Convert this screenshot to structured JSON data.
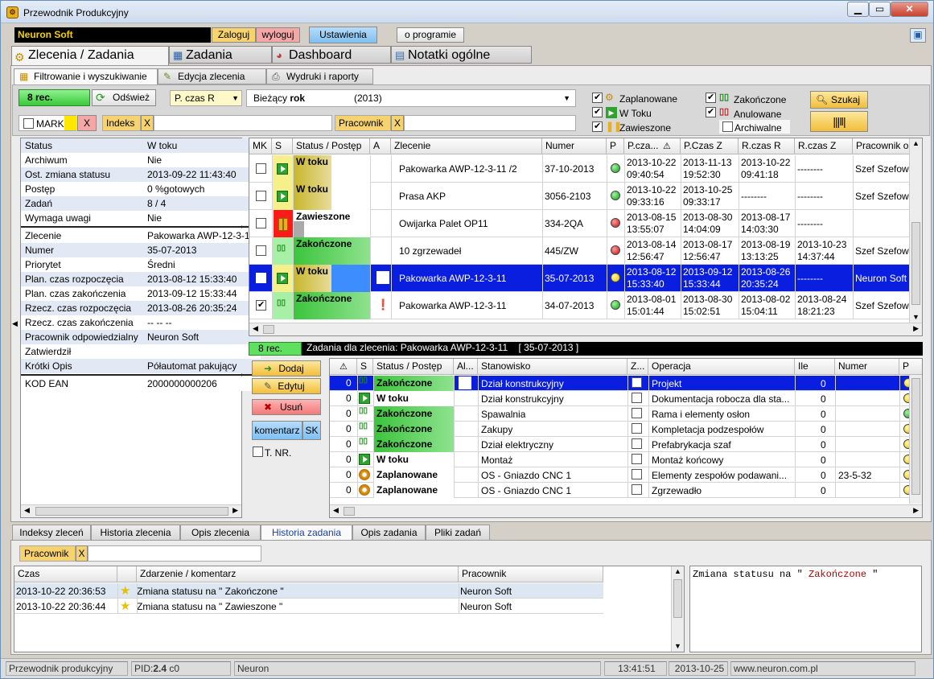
{
  "window": {
    "title": "Przewodnik Produkcyjny"
  },
  "topbar": {
    "brand": "Neuron Soft",
    "login": "Zaloguj",
    "logout": "wyloguj",
    "settings": "Ustawienia",
    "about": "o programie"
  },
  "main_tabs": [
    "Zlecenia / Zadania",
    "Zadania",
    "Dashboard",
    "Notatki ogólne"
  ],
  "sub_tabs": [
    "Filtrowanie i wyszukiwanie",
    "Edycja zlecenia",
    "Wydruki i raporty"
  ],
  "filter": {
    "rec_count": "8 rec.",
    "refresh": "Odśwież",
    "time_field": "P. czas R",
    "period_label": "Bieżący",
    "period_bold": "rok",
    "period_year": "(2013)",
    "mark": "MARK",
    "x": "X",
    "index_label": "Indeks",
    "index_value": "",
    "worker_label": "Pracownik",
    "worker_value": "",
    "cb_planned": "Zaplanowane",
    "cb_inprogress": "W Toku",
    "cb_suspended": "Zawieszone",
    "cb_finished": "Zakończone",
    "cb_cancelled": "Anulowane",
    "cb_archived": "Archiwalne",
    "search": "Szukaj"
  },
  "details": [
    {
      "k": "Status",
      "v": "W toku",
      "hl": true
    },
    {
      "k": "Archiwum",
      "v": "Nie"
    },
    {
      "k": "Ost. zmiana statusu",
      "v": "2013-09-22  11:43:40",
      "hl": true
    },
    {
      "k": "Postęp",
      "v": "0 %gotowych"
    },
    {
      "k": "Zadań",
      "v": "8 / 4",
      "hl": true
    },
    {
      "k": "Wymaga uwagi",
      "v": "Nie"
    },
    {
      "k": "Zlecenie",
      "v": "Pakowarka AWP-12-3-11"
    },
    {
      "k": "Numer",
      "v": "35-07-2013",
      "hl": true
    },
    {
      "k": "Priorytet",
      "v": "Średni"
    },
    {
      "k": "Plan. czas rozpoczęcia",
      "v": "2013-08-12  15:33:40",
      "hl": true
    },
    {
      "k": "Plan. czas zakończenia",
      "v": "2013-09-12  15:33:44"
    },
    {
      "k": "Rzecz. czas rozpoczęcia",
      "v": "2013-08-26  20:35:24",
      "hl": true
    },
    {
      "k": "Rzecz. czas zakończenia",
      "v": "-- --  --"
    },
    {
      "k": "Pracownik odpowiedzialny",
      "v": "Neuron Soft",
      "hl": true
    },
    {
      "k": "Zatwierdził",
      "v": ""
    },
    {
      "k": "Krótki Opis",
      "v": "Półautomat pakujący",
      "hl": true
    },
    {
      "k": "KOD EAN",
      "v": "2000000000206"
    }
  ],
  "orders": {
    "headers": [
      "MK",
      "S",
      "Status / Postęp",
      "A",
      "Zlecenie",
      "Numer",
      "P",
      "P.cza...",
      "P.Czas Z",
      "R.czas R",
      "R.czas Z",
      "Pracownik o"
    ],
    "rows": [
      {
        "mk": false,
        "status": "W toku",
        "zlecenie": "Pakowarka AWP-12-3-11 /2",
        "numer": "37-10-2013",
        "p": "green",
        "pczas": "2013-10-22\n09:40:54",
        "pczasz": "2013-11-13\n19:52:30",
        "rczasr": "2013-10-22\n09:41:18",
        "rczasz": "--------",
        "prac": "Szef Szefowi"
      },
      {
        "mk": false,
        "status": "W toku",
        "zlecenie": "Prasa AKP",
        "numer": "3056-2103",
        "p": "green",
        "pczas": "2013-10-22\n09:33:16",
        "pczasz": "2013-10-25\n09:33:17",
        "rczasr": "--------",
        "rczasz": "--------",
        "prac": "Szef Szefowi"
      },
      {
        "mk": false,
        "status": "Zawieszone",
        "zlecenie": "Owijarka Palet OP11",
        "numer": "334-2QA",
        "p": "red",
        "pczas": "2013-08-15\n13:55:07",
        "pczasz": "2013-08-30\n14:04:09",
        "rczasr": "2013-08-17\n14:03:30",
        "rczasz": "--------",
        "prac": ""
      },
      {
        "mk": false,
        "status": "Zakończone",
        "zlecenie": "10 zgrzewadeł",
        "numer": "445/ZW",
        "p": "red",
        "pczas": "2013-08-14\n12:56:47",
        "pczasz": "2013-08-17\n12:56:47",
        "rczasr": "2013-08-19\n13:13:25",
        "rczasz": "2013-10-23\n14:37:44",
        "prac": "Szef Szefowi"
      },
      {
        "mk": false,
        "status": "W toku",
        "zlecenie": "Pakowarka AWP-12-3-11",
        "numer": "35-07-2013",
        "p": "yellow",
        "pczas": "2013-08-12\n15:33:40",
        "pczasz": "2013-09-12\n15:33:44",
        "rczasr": "2013-08-26\n20:35:24",
        "rczasz": "--------",
        "prac": "Neuron Soft"
      },
      {
        "mk": true,
        "status": "Zakończone",
        "zlecenie": "Pakowarka AWP-12-3-11",
        "numer": "34-07-2013",
        "p": "green",
        "pczas": "2013-08-01\n15:01:44",
        "pczasz": "2013-08-30\n15:02:51",
        "rczasr": "2013-08-02\n15:04:11",
        "rczasz": "2013-08-24\n18:21:23",
        "prac": "Szef Szefowi"
      }
    ]
  },
  "tasks": {
    "rec_count": "8 rec.",
    "title_prefix": "Zadania dla zlecenia:  Pakowarka AWP-12-3-11",
    "title_num": "[ 35-07-2013 ]",
    "add": "Dodaj",
    "edit": "Edytuj",
    "delete": "Usuń",
    "comment": "komentarz",
    "sk": "SK",
    "tnr": "T. NR.",
    "headers": [
      "",
      "S",
      "Status / Postęp",
      "Al...",
      "Stanowisko",
      "Z...",
      "Operacja",
      "Ile",
      "Numer",
      "P"
    ],
    "rows": [
      {
        "n": "0",
        "status": "Zakończone",
        "st": "Dział konstrukcyjny",
        "op": "Projekt",
        "ile": "0",
        "num": ""
      },
      {
        "n": "0",
        "status": "W toku",
        "st": "Dział konstrukcyjny",
        "op": "Dokumentacja robocza dla sta...",
        "ile": "0",
        "num": ""
      },
      {
        "n": "0",
        "status": "Zakończone",
        "st": "Spawalnia",
        "op": "Rama i elementy osłon",
        "ile": "0",
        "num": ""
      },
      {
        "n": "0",
        "status": "Zakończone",
        "st": "Zakupy",
        "op": "Kompletacja podzespołów",
        "ile": "0",
        "num": ""
      },
      {
        "n": "0",
        "status": "Zakończone",
        "st": "Dział elektryczny",
        "op": "Prefabrykacja szaf",
        "ile": "0",
        "num": ""
      },
      {
        "n": "0",
        "status": "W toku",
        "st": "Montaż",
        "op": "Montaż końcowy",
        "ile": "0",
        "num": ""
      },
      {
        "n": "0",
        "status": "Zaplanowane",
        "st": "OS - Gniazdo CNC 1",
        "op": "Elementy zespołów podawani...",
        "ile": "0",
        "num": "23-5-32"
      },
      {
        "n": "0",
        "status": "Zaplanowane",
        "st": "OS - Gniazdo CNC 1",
        "op": "Zgrzewadło",
        "ile": "0",
        "num": ""
      }
    ]
  },
  "bottom_tabs": [
    "Indeksy zleceń",
    "Historia zlecenia",
    "Opis zlecenia",
    "Historia zadania",
    "Opis zadania",
    "Pliki zadań"
  ],
  "history": {
    "worker_label": "Pracownik",
    "headers": [
      "Czas",
      "Zdarzenie / komentarz",
      "Pracownik"
    ],
    "rows": [
      {
        "czas": "2013-10-22  20:36:53",
        "ev": "Zmiana statusu na \" Zakończone \"",
        "pr": "Neuron Soft"
      },
      {
        "czas": "2013-10-22  20:36:44",
        "ev": "Zmiana statusu na \" Zawieszone \"",
        "pr": "Neuron Soft"
      }
    ],
    "note_prefix": "Zmiana statusu na \"",
    "note_status": " Zakończone ",
    "note_suffix": "\""
  },
  "statusbar": {
    "app": "Przewodnik produkcyjny",
    "pid_label": "PID:",
    "pid_val": "2.4",
    "pid_c": "c0",
    "company": "Neuron",
    "time": "13:41:51",
    "date": "2013-10-25",
    "url": "www.neuron.com.pl"
  }
}
